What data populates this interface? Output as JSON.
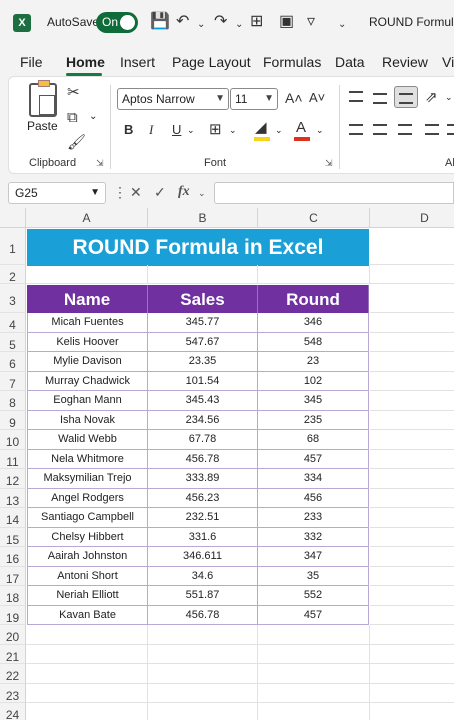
{
  "titlebar": {
    "logo": "X",
    "autosave_label": "AutoSave",
    "toggle_state": "On",
    "doc_title": "ROUND Formula"
  },
  "menu": {
    "tabs": [
      "File",
      "Home",
      "Insert",
      "Page Layout",
      "Formulas",
      "Data",
      "Review",
      "Vi"
    ],
    "active": "Home"
  },
  "ribbon": {
    "paste_label": "Paste",
    "clipboard_label": "Clipboard",
    "font_name": "Aptos Narrow",
    "font_size": "11",
    "bold": "B",
    "italic": "I",
    "underline": "U",
    "font_label": "Font",
    "alignment_label": "Al",
    "grow_font": "A˄",
    "shrink_font": "A˅",
    "font_color_letter": "A",
    "icons": [
      "cut-icon",
      "copy-icon",
      "format-painter-icon",
      "borders-icon",
      "fill-color-icon",
      "font-color-icon",
      "align-top-icon",
      "align-middle-icon",
      "align-bottom-icon",
      "orientation-icon",
      "align-left-icon",
      "align-center-icon",
      "align-right-icon",
      "decrease-indent-icon"
    ],
    "colors": {
      "fill_bar": "#f7d31e",
      "font_bar": "#e0301e"
    }
  },
  "formula_bar": {
    "name_box": "G25",
    "cancel": "✕",
    "enter": "✓",
    "fx": "fx",
    "formula": ""
  },
  "sheet": {
    "columns": [
      "A",
      "B",
      "C",
      "D"
    ],
    "rows": [
      "1",
      "2",
      "3",
      "4",
      "5",
      "6",
      "7",
      "8",
      "9",
      "10",
      "11",
      "12",
      "13",
      "14",
      "15",
      "16",
      "17",
      "18",
      "19",
      "20",
      "21",
      "22",
      "23",
      "24"
    ],
    "title": "ROUND Formula in Excel",
    "headers": [
      "Name",
      "Sales",
      "Round"
    ],
    "data": [
      [
        "Micah Fuentes",
        "345.77",
        "346"
      ],
      [
        "Kelis Hoover",
        "547.67",
        "548"
      ],
      [
        "Mylie Davison",
        "23.35",
        "23"
      ],
      [
        "Murray Chadwick",
        "101.54",
        "102"
      ],
      [
        "Eoghan Mann",
        "345.43",
        "345"
      ],
      [
        "Isha Novak",
        "234.56",
        "235"
      ],
      [
        "Walid Webb",
        "67.78",
        "68"
      ],
      [
        "Nela Whitmore",
        "456.78",
        "457"
      ],
      [
        "Maksymilian Trejo",
        "333.89",
        "334"
      ],
      [
        "Angel Rodgers",
        "456.23",
        "456"
      ],
      [
        "Santiago Campbell",
        "232.51",
        "233"
      ],
      [
        "Chelsy Hibbert",
        "331.6",
        "332"
      ],
      [
        "Aairah Johnston",
        "346.611",
        "347"
      ],
      [
        "Antoni Short",
        "34.6",
        "35"
      ],
      [
        "Neriah Elliott",
        "551.87",
        "552"
      ],
      [
        "Kavan Bate",
        "456.78",
        "457"
      ]
    ],
    "colors": {
      "title_fill": "#1a9fd6",
      "header_fill": "#7030a0"
    }
  }
}
